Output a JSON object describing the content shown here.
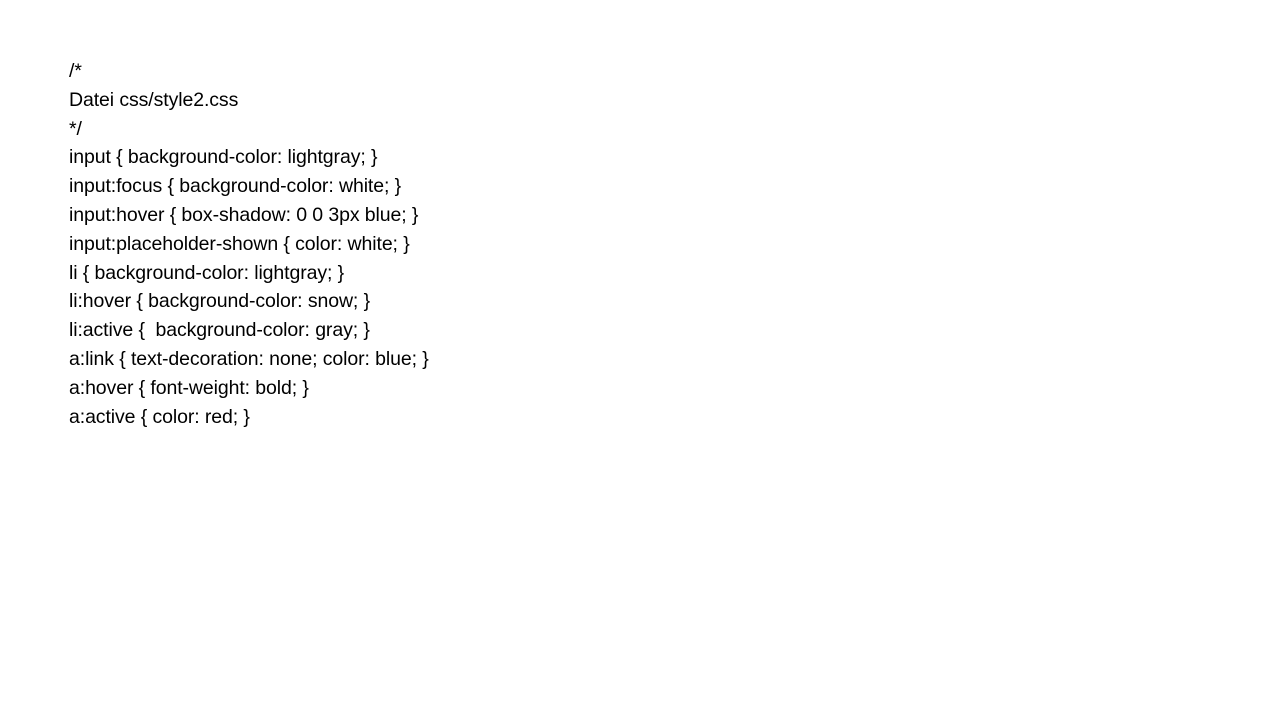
{
  "document": {
    "lines": [
      "/*",
      "Datei css/style2.css",
      "*/",
      "input { background-color: lightgray; }",
      "input:focus { background-color: white; }",
      "input:hover { box-shadow: 0 0 3px blue; }",
      "input:placeholder-shown { color: white; }",
      "li { background-color: lightgray; }",
      "li:hover { background-color: snow; }",
      "li:active {  background-color: gray; }",
      "a:link { text-decoration: none; color: blue; }",
      "a:hover { font-weight: bold; }",
      "a:active { color: red; }"
    ]
  }
}
